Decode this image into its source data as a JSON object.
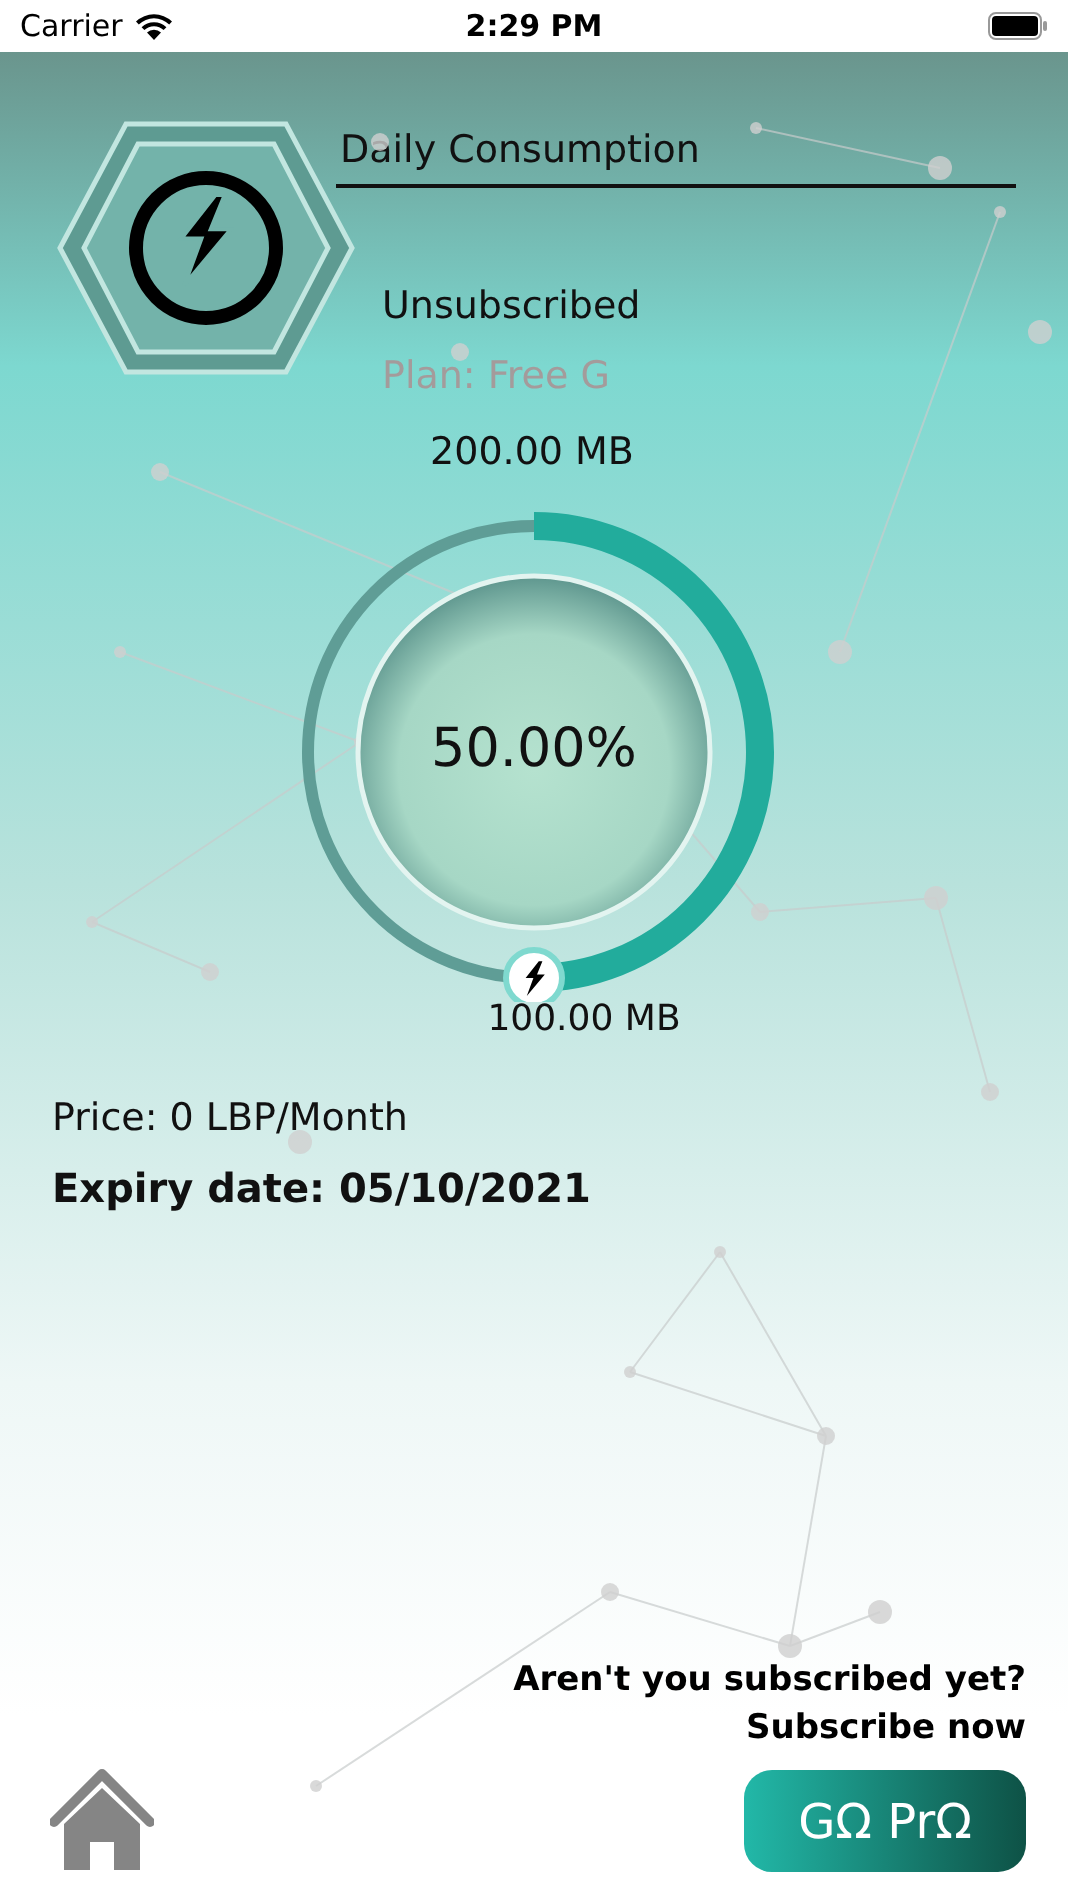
{
  "status_bar": {
    "carrier": "Carrier",
    "time": "2:29 PM"
  },
  "header": {
    "title": "Daily Consumption",
    "status": "Unsubscribed",
    "plan": "Plan: Free G"
  },
  "usage": {
    "total": "200.00 MB",
    "percent": "50.00%",
    "level": 0.5,
    "used": "100.00 MB"
  },
  "details": {
    "price": "Price: 0 LBP/Month",
    "expiry": "Expiry date: 05/10/2021"
  },
  "promo": {
    "question": "Aren't you subscribed yet?",
    "cta": "Subscribe now",
    "button": "GΩ PrΩ"
  }
}
